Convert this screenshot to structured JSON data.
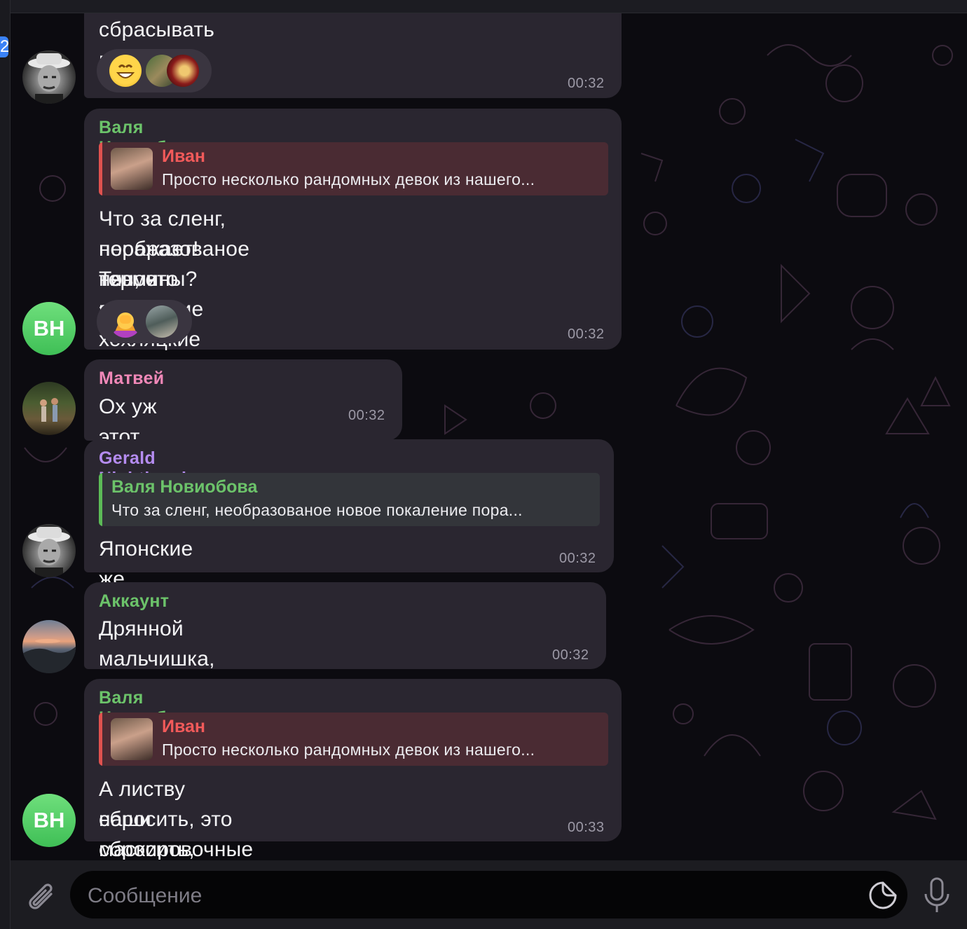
{
  "left_badge": "2",
  "composer": {
    "placeholder": "Сообщение"
  },
  "messages": [
    {
      "id": "m1",
      "text": "сбрасывать мусор",
      "time": "00:32",
      "avatar_icon": "man-in-hat-photo",
      "reactions": [
        "grinning-face-emoji",
        "photo-avatar-1",
        "photo-avatar-2"
      ]
    },
    {
      "id": "m2",
      "sender": "Валя Новиобова",
      "sender_color": "#6cc36a",
      "reply": {
        "name": "Иван",
        "name_color": "#f25a5a",
        "bar_color": "#e0524f",
        "text": "Просто несколько рандомных девок из нашего..."
      },
      "text_lines": [
        "Что за сленг, необразованое новое покаление",
        "поражает! Тян, что это? Не хохляцкие ли",
        "термины?"
      ],
      "time": "00:32",
      "avatar_initials": "ВН",
      "reactions": [
        "facepalm-emoji",
        "photo-avatar-3"
      ]
    },
    {
      "id": "m3",
      "sender": "Матвей",
      "sender_color": "#f088b8",
      "text": "Ох уж этот илюшка",
      "emoji": "😂",
      "time": "00:32",
      "avatar_icon": "two-people-photo"
    },
    {
      "id": "m4",
      "sender": "Gerald Nightingale",
      "sender_color": "#b58cf0",
      "reply": {
        "name": "Валя Новиобова",
        "name_color": "#6cc36a",
        "bar_color": "#5cbb57",
        "text": "Что за сленг, необразованое новое покаление пора..."
      },
      "text": "Японские же",
      "time": "00:32",
      "avatar_icon": "man-in-hat-photo"
    },
    {
      "id": "m5",
      "sender": "Аккаунт",
      "sender_color": "#6cc36a",
      "text": "Дрянной мальчишка, правильно его наказали!",
      "time": "00:32",
      "avatar_icon": "sunset-photo"
    },
    {
      "id": "m6",
      "sender": "Валя Новиобова",
      "sender_color": "#6cc36a",
      "reply": {
        "name": "Иван",
        "name_color": "#f25a5a",
        "bar_color": "#e0524f",
        "text": "Просто несколько рандомных девок из нашего..."
      },
      "text_lines": [
        "А листву сбросить, это маскировочные сети",
        "наши сбросить, хохол!?"
      ],
      "time": "00:33",
      "avatar_initials": "ВН"
    }
  ]
}
